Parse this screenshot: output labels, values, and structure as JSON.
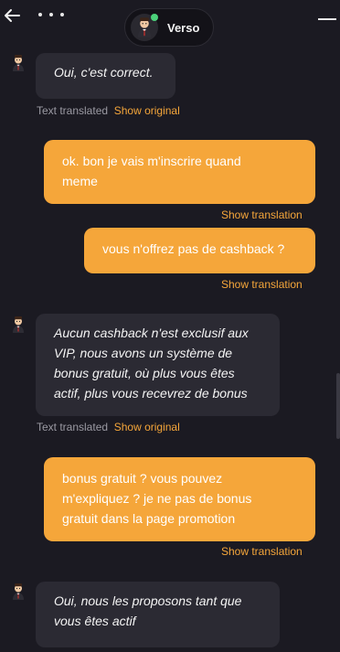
{
  "header": {
    "agent_name": "Verso",
    "back_icon": "arrow-left-icon",
    "more_icon": "more-dots-icon",
    "minimize_icon": "minimize-icon",
    "online_color": "#4bd17a"
  },
  "colors": {
    "background": "#1b1a22",
    "agent_bubble": "#2b2a33",
    "user_bubble": "#f5a63a",
    "accent": "#f5a63a"
  },
  "messages": [
    {
      "sender": "agent",
      "lines": [
        "Oui, c'est correct."
      ],
      "meta_text": "Text translated",
      "meta_link": "Show original"
    },
    {
      "sender": "user",
      "lines": [
        "ok. bon je vais m'inscrire quand",
        "meme"
      ],
      "meta_link": "Show translation"
    },
    {
      "sender": "user",
      "lines": [
        "vous n'offrez pas de cashback ?"
      ],
      "meta_link": "Show translation"
    },
    {
      "sender": "agent",
      "lines": [
        "Aucun cashback n'est exclusif aux",
        "VIP, nous avons un système de",
        "bonus gratuit, où plus vous êtes",
        "actif, plus vous recevrez de bonus"
      ],
      "meta_text": "Text translated",
      "meta_link": "Show original"
    },
    {
      "sender": "user",
      "lines": [
        "bonus gratuit ? vous pouvez",
        "m'expliquez ? je ne pas de bonus",
        "gratuit dans la page promotion"
      ],
      "meta_link": "Show translation"
    },
    {
      "sender": "agent",
      "lines": [
        "Oui, nous les proposons tant que",
        "vous êtes actif"
      ]
    }
  ]
}
